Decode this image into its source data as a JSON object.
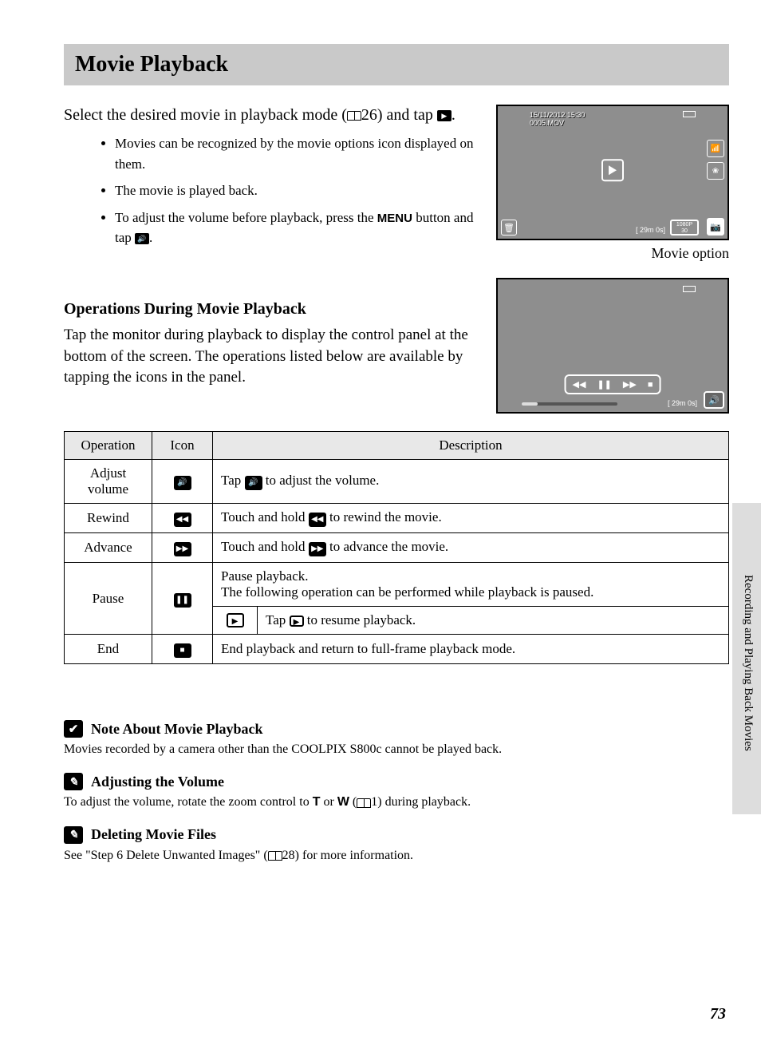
{
  "title": "Movie Playback",
  "instruction": {
    "prefix": "Select the desired movie in playback mode (",
    "ref": "26",
    "suffix": ") and tap "
  },
  "bullets": [
    "Movies can be recognized by the movie options icon displayed on them.",
    "The movie is played back.",
    "To adjust the volume before playback, press the "
  ],
  "bullet3_mid": " button and tap ",
  "menu_word": "MENU",
  "screenshot1": {
    "date": "15/11/2012 15:30",
    "file": "0005.MOV",
    "res_top": "1080P",
    "res_bot": "30",
    "time": "29m 0s",
    "caption": "Movie option"
  },
  "section2": {
    "heading": "Operations During Movie Playback",
    "body": "Tap the monitor during playback to display the control panel at the bottom of the screen. The operations listed below are available by tapping the icons in the panel."
  },
  "screenshot2": {
    "time": "29m 0s"
  },
  "table": {
    "headers": [
      "Operation",
      "Icon",
      "Description"
    ],
    "rows": {
      "volume": {
        "op": "Adjust volume",
        "desc_pre": "Tap ",
        "desc_post": " to adjust the volume."
      },
      "rewind": {
        "op": "Rewind",
        "desc_pre": "Touch and hold ",
        "desc_post": " to rewind the movie."
      },
      "advance": {
        "op": "Advance",
        "desc_pre": "Touch and hold ",
        "desc_post": " to advance the movie."
      },
      "pause": {
        "op": "Pause",
        "desc1": "Pause playback.",
        "desc2": "The following operation can be performed while playback is paused.",
        "resume_pre": "Tap ",
        "resume_post": " to resume playback."
      },
      "end": {
        "op": "End",
        "desc": "End playback and return to full-frame playback mode."
      }
    }
  },
  "notes": {
    "n1": {
      "title": "Note About Movie Playback",
      "body": "Movies recorded by a camera other than the COOLPIX S800c cannot be played back."
    },
    "n2": {
      "title": "Adjusting the Volume",
      "body_pre": "To adjust the volume, rotate the zoom control to ",
      "t": "T",
      "or": " or ",
      "w": "W",
      "body_mid": " (",
      "ref": "1",
      "body_post": ") during playback."
    },
    "n3": {
      "title": "Deleting Movie Files",
      "body_pre": "See \"Step 6 Delete Unwanted Images\" (",
      "ref": "28",
      "body_post": ") for more information."
    }
  },
  "side_label": "Recording and Playing Back Movies",
  "page_number": "73"
}
